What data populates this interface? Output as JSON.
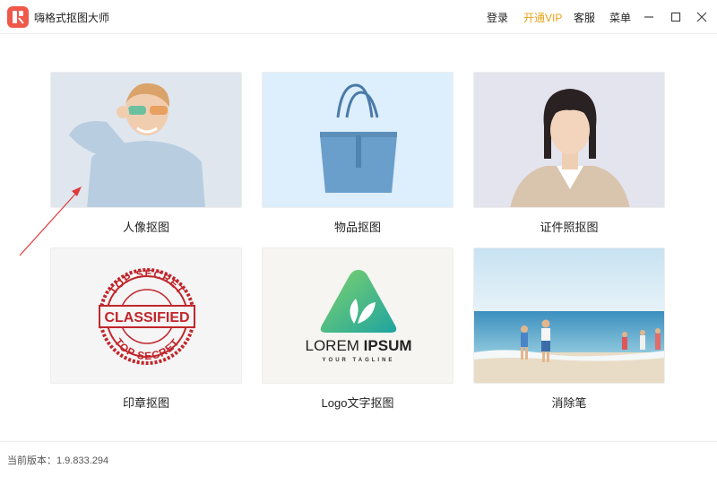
{
  "app": {
    "title": "嗨格式抠图大师"
  },
  "nav": {
    "login": "登录",
    "vip": "开通VIP",
    "service": "客服",
    "menu": "菜单"
  },
  "cards": [
    {
      "label": "人像抠图"
    },
    {
      "label": "物品抠图"
    },
    {
      "label": "证件照抠图"
    },
    {
      "label": "印章抠图",
      "stamp_top": "TOP SECRET",
      "stamp_center": "CLASSIFIED",
      "stamp_bottom": "TOP SECRET"
    },
    {
      "label": "Logo文字抠图",
      "logo_main_a": "LOREM ",
      "logo_main_b": "IPSUM",
      "logo_tagline": "YOUR TAGLINE"
    },
    {
      "label": "消除笔"
    }
  ],
  "footer": {
    "version": "当前版本：1.9.833.294"
  },
  "colors": {
    "vip": "#e8a317",
    "accent": "#f0584a",
    "stamp": "#c0262c"
  }
}
